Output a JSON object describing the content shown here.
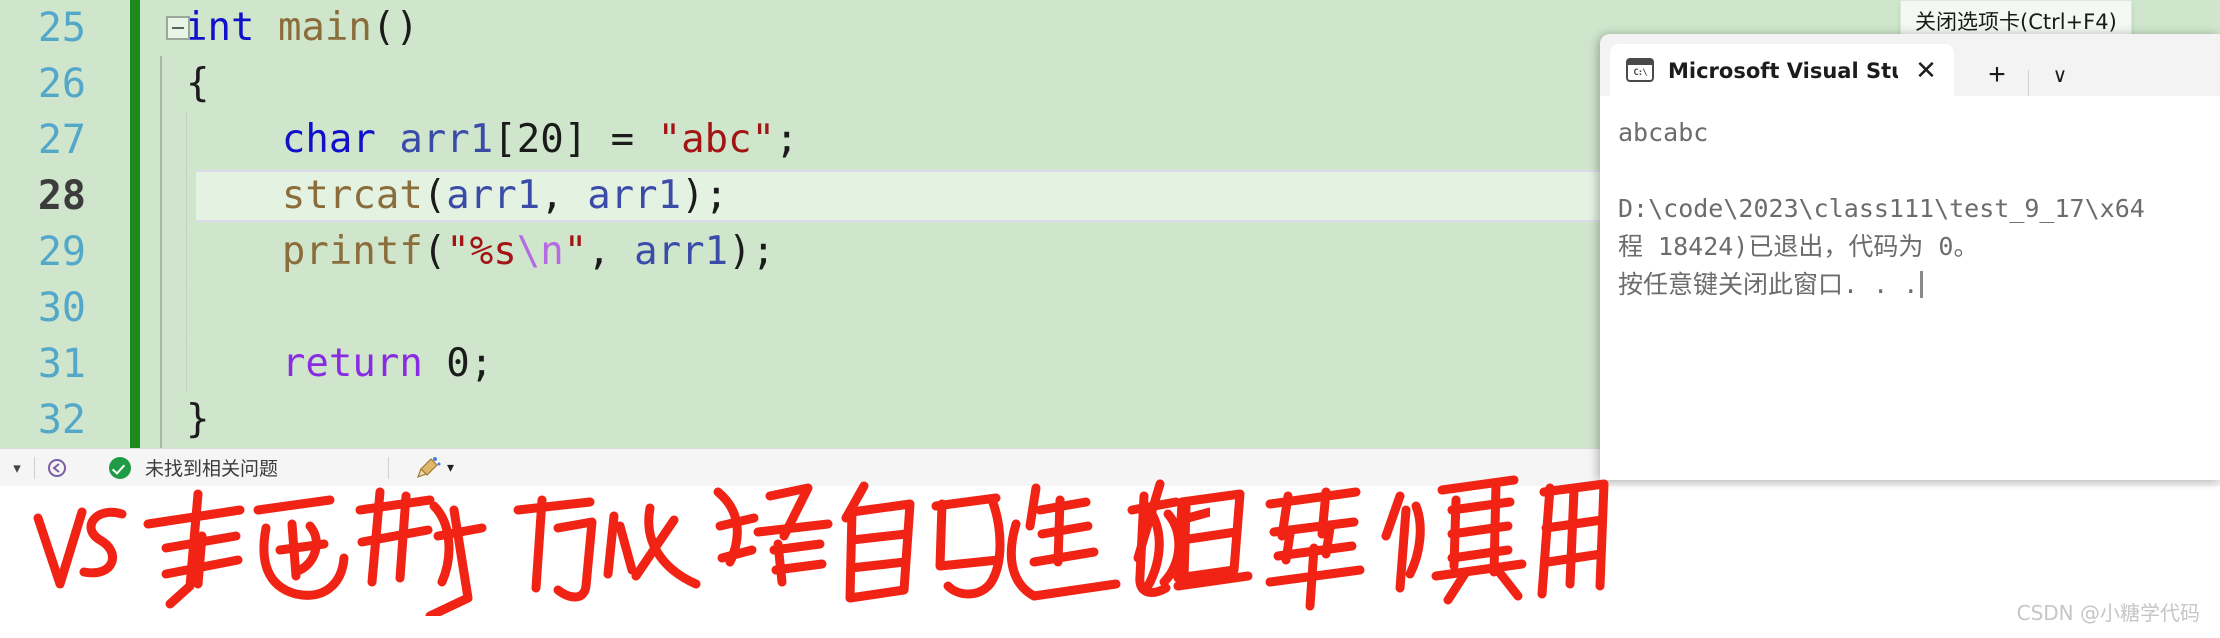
{
  "editor": {
    "background_color": "#cfe6cc",
    "current_line": 28,
    "lines": [
      {
        "number": "25",
        "text": "int main()",
        "collapsible": true
      },
      {
        "number": "26",
        "text": "{"
      },
      {
        "number": "27",
        "text": "    char arr1[20] = \"abc\";"
      },
      {
        "number": "28",
        "text": "    strcat(arr1, arr1);"
      },
      {
        "number": "29",
        "text": "    printf(\"%s\\n\", arr1);"
      },
      {
        "number": "30",
        "text": ""
      },
      {
        "number": "31",
        "text": "    return 0;"
      },
      {
        "number": "32",
        "text": "}"
      }
    ]
  },
  "statusbar": {
    "caret_label": "▾",
    "nav_icon": "navigate-backward-icon",
    "status_text": "未找到相关问题",
    "brush_icon": "code-cleanup-icon",
    "brush_caret": "▾"
  },
  "console": {
    "tab": {
      "icon_label": "C:\\",
      "title": "Microsoft Visual Studio 调试扣",
      "close_label": "✕",
      "new_tab_label": "+",
      "dropdown_label": "∨"
    },
    "output": {
      "line1": "abcabc",
      "line2": "",
      "line3": "D:\\code\\2023\\class111\\test_9_17\\x64",
      "line4": "程 18424)已退出，代码为 0。",
      "line5": "按任意键关闭此窗口. . ."
    }
  },
  "tooltip": {
    "text": "关闭选项卡(Ctrl+F4)"
  },
  "annotation": {
    "text": "VS库函数可以给自己追加但要慎用",
    "color": "#f02315"
  },
  "watermark": {
    "text": "CSDN @小糖学代码"
  }
}
